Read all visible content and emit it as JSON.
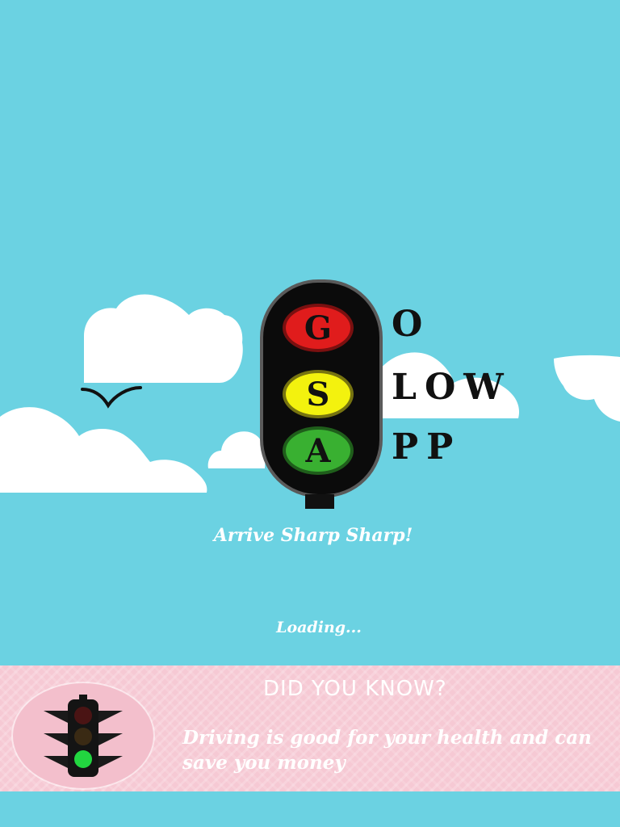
{
  "logo": {
    "letters": {
      "top": "G",
      "middle": "S",
      "bottom": "A"
    },
    "words": {
      "top": "O",
      "middle": "LOW",
      "bottom": "PP"
    },
    "colors": {
      "red": "#e01c1c",
      "yellow": "#f3f20e",
      "green": "#39b031"
    }
  },
  "tagline": "Arrive Sharp Sharp!",
  "status": "Loading...",
  "tip_panel": {
    "heading": "DID YOU KNOW?",
    "text": "Driving is good for your health and can save you money",
    "icon": "traffic-light-icon"
  },
  "theme": {
    "sky": "#6bd2e2",
    "panel": "#f6c9d4",
    "cloud": "#ffffff"
  }
}
